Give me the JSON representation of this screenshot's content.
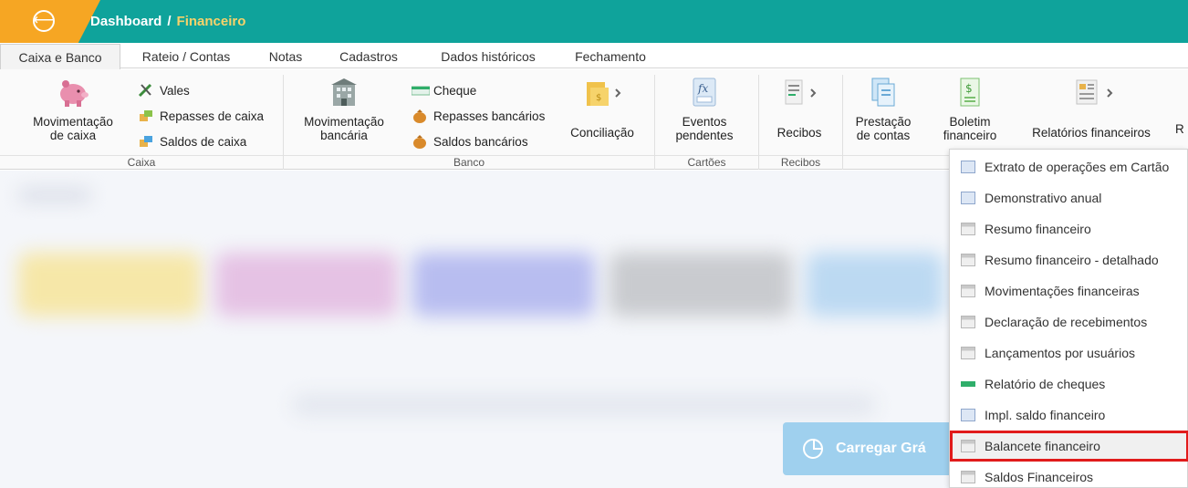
{
  "header": {
    "back_icon_glyph": "⟵",
    "breadcrumb_root": "Dashboard",
    "breadcrumb_sep": "/",
    "breadcrumb_current": "Financeiro",
    "colors": {
      "bar": "#0fa39b",
      "accent": "#f6a623"
    }
  },
  "tabs": [
    {
      "label": "Caixa e Banco"
    },
    {
      "label": "Rateio / Contas"
    },
    {
      "label": "Notas"
    },
    {
      "label": "Cadastros"
    },
    {
      "label": "Dados históricos"
    },
    {
      "label": "Fechamento"
    }
  ],
  "ribbon": {
    "caixa": {
      "group_label": "Caixa",
      "movimentacao_line1": "Movimentação",
      "movimentacao_line2": "de caixa",
      "vales": "Vales",
      "repasses": "Repasses de caixa",
      "saldos": "Saldos de caixa"
    },
    "banco": {
      "group_label": "Banco",
      "movimentacao_line1": "Movimentação",
      "movimentacao_line2": "bancária",
      "cheque": "Cheque",
      "repasses": "Repasses bancários",
      "saldos": "Saldos bancários",
      "conciliacao": "Conciliação"
    },
    "cartoes": {
      "group_label": "Cartões",
      "eventos_line1": "Eventos",
      "eventos_line2": "pendentes"
    },
    "recibos": {
      "group_label": "Recibos",
      "recibos": "Recibos"
    },
    "outros": {
      "prestacao_line1": "Prestação",
      "prestacao_line2": "de contas",
      "boletim_line1": "Boletim",
      "boletim_line2": "financeiro",
      "relatorios": "Relatórios financeiros",
      "cut_label": "R"
    }
  },
  "background": {
    "carregar_label": "Carregar Grá"
  },
  "dropdown": {
    "items": [
      {
        "label": "Extrato de operações em Cartão",
        "icon": "card-icon"
      },
      {
        "label": "Demonstrativo anual",
        "icon": "card-icon"
      },
      {
        "label": "Resumo financeiro",
        "icon": "doc-icon"
      },
      {
        "label": "Resumo financeiro - detalhado",
        "icon": "doc-icon"
      },
      {
        "label": "Movimentações financeiras",
        "icon": "doc-icon"
      },
      {
        "label": "Declaração de recebimentos",
        "icon": "doc-icon"
      },
      {
        "label": "Lançamentos por usuários",
        "icon": "doc-icon"
      },
      {
        "label": "Relatório de cheques",
        "icon": "cheque-icon"
      },
      {
        "label": "Impl. saldo financeiro",
        "icon": "card-icon"
      },
      {
        "label": "Balancete financeiro",
        "icon": "doc-icon",
        "selected": true
      },
      {
        "label": "Saldos Financeiros",
        "icon": "doc-icon"
      }
    ]
  }
}
